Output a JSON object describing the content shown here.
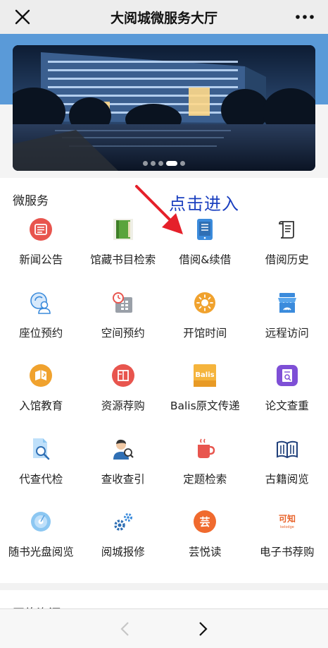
{
  "header": {
    "title": "大阅城微服务大厅"
  },
  "banner": {
    "slide_count": 5,
    "active_slide": 4
  },
  "services": {
    "section_title": "微服务",
    "hint_text": "点击进入",
    "items": [
      {
        "label": "新闻公告",
        "icon": "newspaper-icon"
      },
      {
        "label": "馆藏书目检索",
        "icon": "book-icon"
      },
      {
        "label": "借阅&续借",
        "icon": "tablet-icon"
      },
      {
        "label": "借阅历史",
        "icon": "scroll-icon"
      },
      {
        "label": "座位预约",
        "icon": "seat-user-icon"
      },
      {
        "label": "空间预约",
        "icon": "calendar-clock-icon"
      },
      {
        "label": "开馆时间",
        "icon": "sun-icon"
      },
      {
        "label": "远程访问",
        "icon": "storefront-icon"
      },
      {
        "label": "入馆教育",
        "icon": "education-icon"
      },
      {
        "label": "资源荐购",
        "icon": "recommend-book-icon"
      },
      {
        "label": "Balis原文传递",
        "icon": "balis-logo-icon",
        "icon_text": "Balis"
      },
      {
        "label": "论文查重",
        "icon": "paper-check-icon"
      },
      {
        "label": "代查代检",
        "icon": "document-search-icon"
      },
      {
        "label": "查收查引",
        "icon": "person-search-icon"
      },
      {
        "label": "定题检索",
        "icon": "cup-icon"
      },
      {
        "label": "古籍阅览",
        "icon": "open-book-icon"
      },
      {
        "label": "随书光盘阅览",
        "icon": "disc-icon"
      },
      {
        "label": "阅城报修",
        "icon": "gears-icon"
      },
      {
        "label": "芸悦读",
        "icon": "yun-logo-icon",
        "icon_text": "芸"
      },
      {
        "label": "电子书荐购",
        "icon": "kezhi-logo-icon",
        "icon_text": "可知",
        "icon_subtext": "kelodge"
      }
    ]
  },
  "next_section": {
    "title": "网络资源"
  },
  "colors": {
    "header_bg": "#ededed",
    "banner_blue": "#5a9ad8",
    "hint_blue": "#1a3fbf",
    "arrow_red": "#e5202a",
    "icon_red": "#e8554e",
    "icon_blue": "#3b8bdc",
    "icon_orange": "#f0a22e"
  }
}
